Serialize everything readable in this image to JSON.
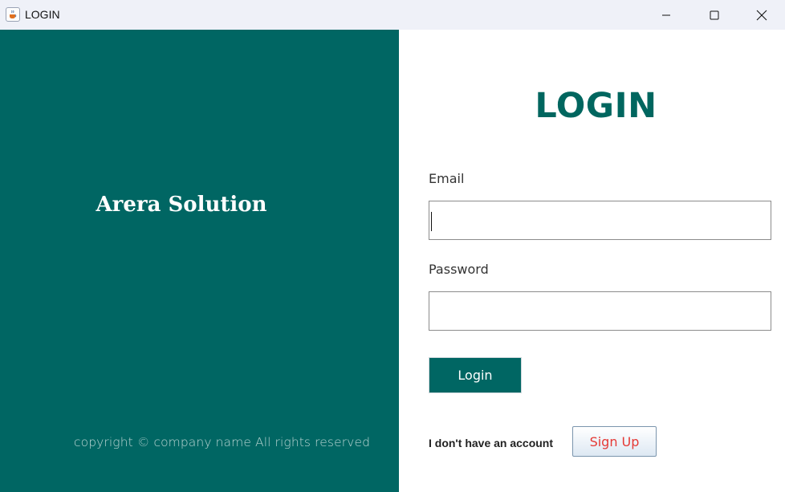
{
  "window": {
    "title": "LOGIN",
    "icons": [
      "java-cup-icon",
      "minimize-icon",
      "maximize-icon",
      "close-icon"
    ]
  },
  "left_panel": {
    "brand": "Arera Solution",
    "copyright": "copyright ©  company name All rights reserved",
    "background": "#006663"
  },
  "form": {
    "heading": "LOGIN",
    "email_label": "Email",
    "email_value": "",
    "password_label": "Password",
    "password_value": "",
    "login_label": "Login",
    "no_account_text": "I don't have an account",
    "signup_label": "Sign Up"
  },
  "colors": {
    "accent": "#006663",
    "signup_text": "#e53935"
  }
}
